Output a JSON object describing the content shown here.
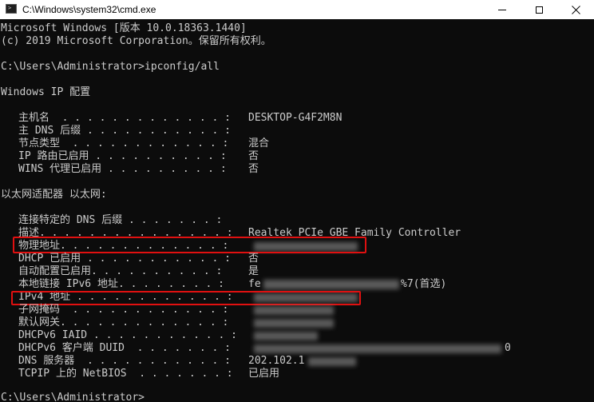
{
  "window": {
    "title": "C:\\Windows\\system32\\cmd.exe",
    "icon": "cmd-icon",
    "controls": {
      "minimize": "minimize-icon",
      "maximize": "maximize-icon",
      "close": "close-icon"
    }
  },
  "console": {
    "header_lines": [
      "Microsoft Windows [版本 10.0.18363.1440]",
      "(c) 2019 Microsoft Corporation。保留所有权利。"
    ],
    "command_line": "C:\\Users\\Administrator>ipconfig/all",
    "ip_config_heading": "Windows IP 配置",
    "ip_config_rows": [
      {
        "label": "主机名  . . . . . . . . . . . . . :",
        "value": "DESKTOP-G4F2M8N"
      },
      {
        "label": "主 DNS 后缀 . . . . . . . . . . . :",
        "value": ""
      },
      {
        "label": "节点类型  . . . . . . . . . . . . :",
        "value": "混合"
      },
      {
        "label": "IP 路由已启用 . . . . . . . . . . :",
        "value": "否"
      },
      {
        "label": "WINS 代理已启用 . . . . . . . . . :",
        "value": "否"
      }
    ],
    "adapter_heading": "以太网适配器 以太网:",
    "adapter_rows": [
      {
        "label": "连接特定的 DNS 后缀 . . . . . . . :",
        "value": ""
      },
      {
        "label": "描述. . . . . . . . . . . . . . . :",
        "value": "Realtek PCIe GBE Family Controller"
      },
      {
        "label": "物理地址. . . . . . . . . . . . . :",
        "value": ""
      },
      {
        "label": "DHCP 已启用 . . . . . . . . . . . :",
        "value": "否"
      },
      {
        "label": "自动配置已启用. . . . . . . . . . :",
        "value": "是"
      },
      {
        "label": "本地链接 IPv6 地址. . . . . . . . :",
        "value": "fe",
        "suffix": "%7(首选)"
      },
      {
        "label": "IPv4 地址 . . . . . . . . . . . . :",
        "value": ""
      },
      {
        "label": "子网掩码  . . . . . . . . . . . . :",
        "value": ""
      },
      {
        "label": "默认网关. . . . . . . . . . . . . :",
        "value": ""
      },
      {
        "label": "DHCPv6 IAID . . . . . . . . . . . :",
        "value": ""
      },
      {
        "label": "DHCPv6 客户端 DUID  . . . . . . . :",
        "value": "",
        "suffix": "0"
      },
      {
        "label": "DNS 服务器  . . . . . . . . . . . :",
        "value": "202.102.1"
      },
      {
        "label": "TCPIP 上的 NetBIOS  . . . . . . . :",
        "value": "已启用"
      }
    ],
    "final_prompt": "C:\\Users\\Administrator>"
  },
  "colors": {
    "console_background": "#0c0c0c",
    "console_text": "#cccccc",
    "highlight_box": "#e01010",
    "titlebar": "#ffffff"
  }
}
